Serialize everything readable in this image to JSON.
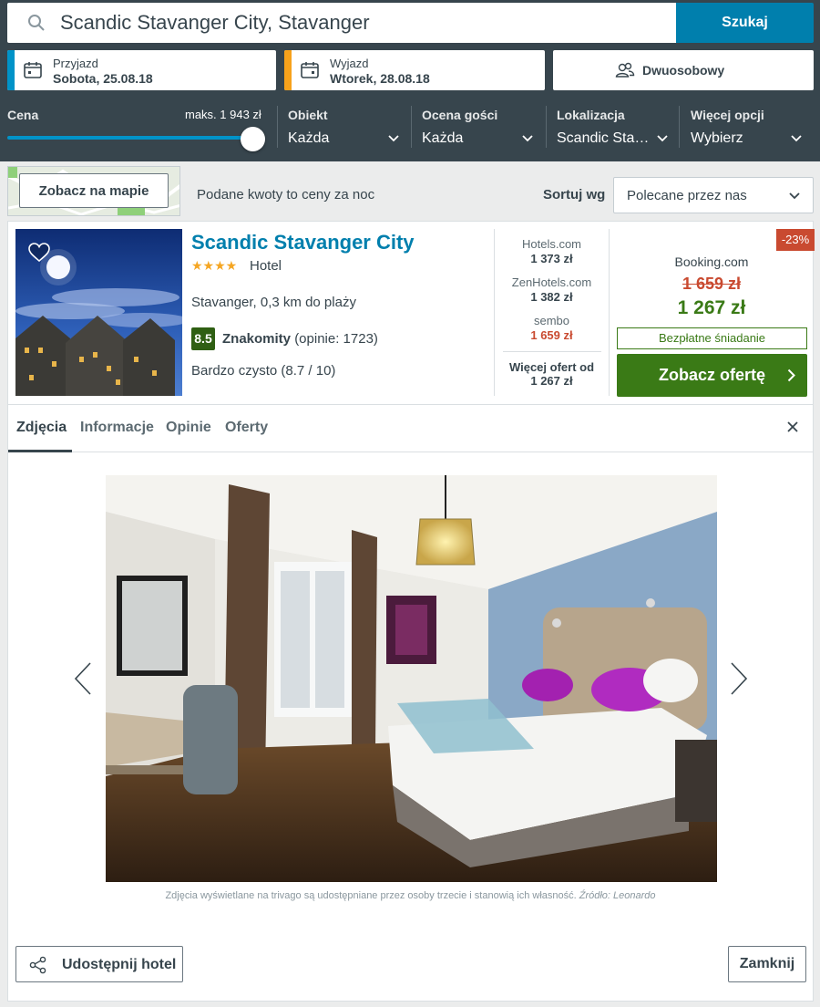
{
  "search": {
    "query": "Scandic Stavanger City, Stavanger",
    "button": "Szukaj"
  },
  "dates": {
    "checkin": {
      "label": "Przyjazd",
      "value": "Sobota, 25.08.18",
      "color": "#0093c8"
    },
    "checkout": {
      "label": "Wyjazd",
      "value": "Wtorek, 28.08.18",
      "color": "#f7a21b"
    }
  },
  "room": {
    "value": "Dwuosobowy"
  },
  "filters": {
    "price": {
      "label": "Cena",
      "max": "maks. 1 943 zł",
      "level_percent": 100
    },
    "object": {
      "label": "Obiekt",
      "value": "Każda"
    },
    "rating": {
      "label": "Ocena gości",
      "value": "Każda"
    },
    "location": {
      "label": "Lokalizacja",
      "value": "Scandic Sta…"
    },
    "more": {
      "label": "Więcej opcji",
      "value": "Wybierz"
    }
  },
  "toolbar": {
    "map_button": "Zobacz na mapie",
    "note": "Podane kwoty to ceny za noc",
    "sort_label": "Sortuj wg",
    "sort_value": "Polecane przez nas"
  },
  "hotel": {
    "name": "Scandic Stavanger City",
    "stars": "★★★★",
    "type": "Hotel",
    "location": "Stavanger, 0,3 km do plaży",
    "rating_score": "8.5",
    "rating_word": "Znakomity",
    "rating_count": "(opinie: 1723)",
    "cleanliness": "Bardzo czysto (8.7 / 10)"
  },
  "deals": [
    {
      "site": "Hotels.com",
      "price": "1 373 zł",
      "highlight": false
    },
    {
      "site": "ZenHotels.com",
      "price": "1 382 zł",
      "highlight": false
    },
    {
      "site": "sembo",
      "price": "1 659 zł",
      "highlight": true
    }
  ],
  "more_offers": {
    "line1": "Więcej ofert od",
    "line2": "1 267 zł"
  },
  "best": {
    "discount": "-23%",
    "site": "Booking.com",
    "old_price": "1 659 zł",
    "new_price": "1 267 zł",
    "perk": "Bezpłatne śniadanie",
    "button": "Zobacz ofertę"
  },
  "tabs": [
    "Zdjęcia",
    "Informacje",
    "Opinie",
    "Oferty"
  ],
  "photo_credit": {
    "text": "Zdjęcia wyświetlane na trivago są udostępniane przez osoby trzecie i stanowią ich własność.",
    "source": "Źródło: Leonardo"
  },
  "footer": {
    "share": "Udostępnij hotel",
    "close": "Zamknij"
  },
  "colors": {
    "header_bg": "#37454d",
    "accent": "#007fad",
    "green": "#3a7a16",
    "red": "#c94a30"
  }
}
